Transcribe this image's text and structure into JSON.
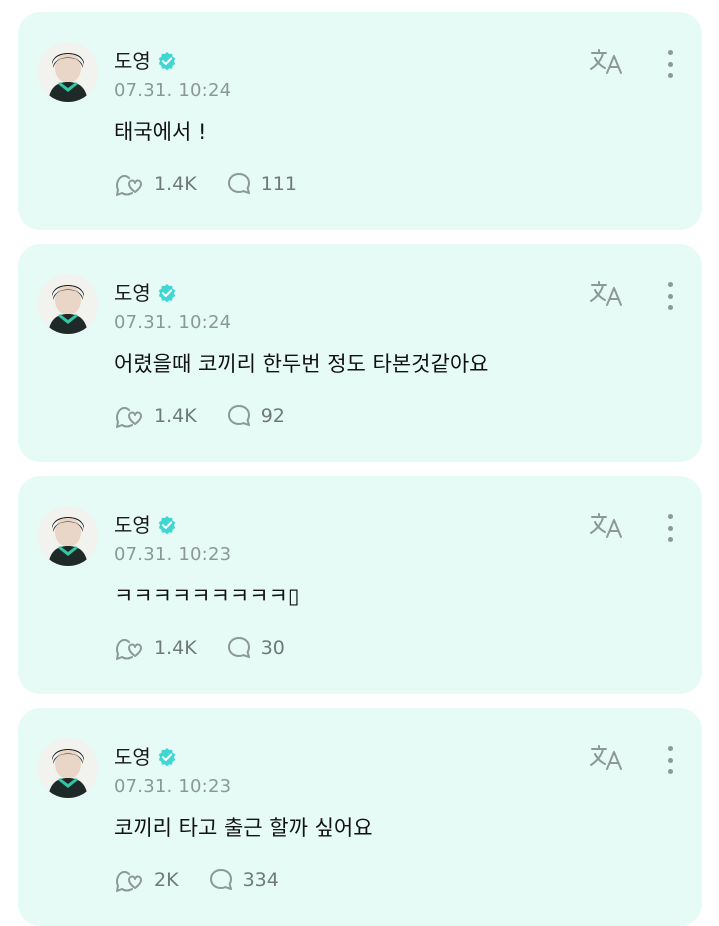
{
  "colors": {
    "card_bg": "#e6fbf6",
    "verified_badge": "#3fd6d3",
    "meta_text": "#8c9894",
    "icon_gray": "#8e9995"
  },
  "posts": [
    {
      "author": "도영",
      "date": "07.31. 10:24",
      "text": "태국에서 !",
      "likes": "1.4K",
      "comments": "111",
      "icons": {
        "like": "bubble-heart-icon",
        "comment": "comment-icon",
        "translate": "translate-icon",
        "more": "more-vertical-icon"
      }
    },
    {
      "author": "도영",
      "date": "07.31. 10:24",
      "text": "어렸을때 코끼리 한두번 정도 타본것같아요",
      "likes": "1.4K",
      "comments": "92",
      "icons": {
        "like": "bubble-heart-icon",
        "comment": "comment-icon",
        "translate": "translate-icon",
        "more": "more-vertical-icon"
      }
    },
    {
      "author": "도영",
      "date": "07.31. 10:23",
      "text": "ㅋㅋㅋㅋㅋㅋㅋㅋㅋ▯",
      "likes": "1.4K",
      "comments": "30",
      "icons": {
        "like": "bubble-heart-icon",
        "comment": "comment-icon",
        "translate": "translate-icon",
        "more": "more-vertical-icon"
      }
    },
    {
      "author": "도영",
      "date": "07.31. 10:23",
      "text": "코끼리 타고 출근 할까 싶어요",
      "likes": "2K",
      "comments": "334",
      "icons": {
        "like": "bubble-heart-icon",
        "comment": "comment-icon",
        "translate": "translate-icon",
        "more": "more-vertical-icon"
      }
    }
  ]
}
